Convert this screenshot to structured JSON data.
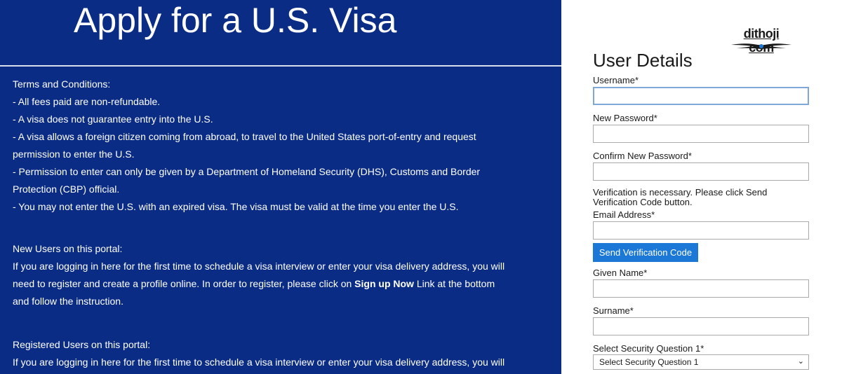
{
  "left": {
    "title": "Apply for a U.S. Visa",
    "terms": {
      "heading": "Terms and Conditions:",
      "lines": [
        "- All fees paid are non-refundable.",
        "- A visa does not guarantee entry into the U.S.",
        "- A visa allows a foreign citizen coming from abroad, to travel to the United States port-of-entry and request",
        "permission to enter the U.S.",
        "- Permission to enter can only be given by a Department of Homeland Security (DHS), Customs and Border",
        "Protection (CBP) official.",
        "- You may not enter the U.S. with an expired visa. The visa must be valid at the time you enter the U.S."
      ]
    },
    "new_users": {
      "heading": "New Users on this portal:",
      "line1": "If you are logging in here for the first time to schedule a visa interview or enter your visa delivery address, you will",
      "line2_pre": "need to register and create a profile online. In order to register, please click on ",
      "line2_bold": "Sign up Now",
      "line2_post": " Link at the bottom",
      "line3": "and follow the instruction."
    },
    "registered_users": {
      "heading": "Registered Users on this portal:",
      "line1": "If you are logging in here for the first time to schedule a visa interview or enter your visa delivery address, you will"
    }
  },
  "form": {
    "logo_text": "dithoji com",
    "title": "User Details",
    "username_label": "Username*",
    "username_value": "",
    "new_password_label": "New Password*",
    "confirm_password_label": "Confirm New Password*",
    "verification_note": "Verification is necessary. Please click Send Verification Code button.",
    "email_label": "Email Address*",
    "send_code_button": "Send Verification Code",
    "given_name_label": "Given Name*",
    "surname_label": "Surname*",
    "security_question_label": "Select Security Question 1*",
    "security_question_value": "Select Security Question 1"
  },
  "colors": {
    "left_panel_bg": "#0a2c84",
    "button_bg": "#1b78d6",
    "focus_border": "#7fa8d8"
  },
  "icons": {
    "logo_wings": "wings-emblem",
    "select_chevron": "chevron-down-icon"
  }
}
